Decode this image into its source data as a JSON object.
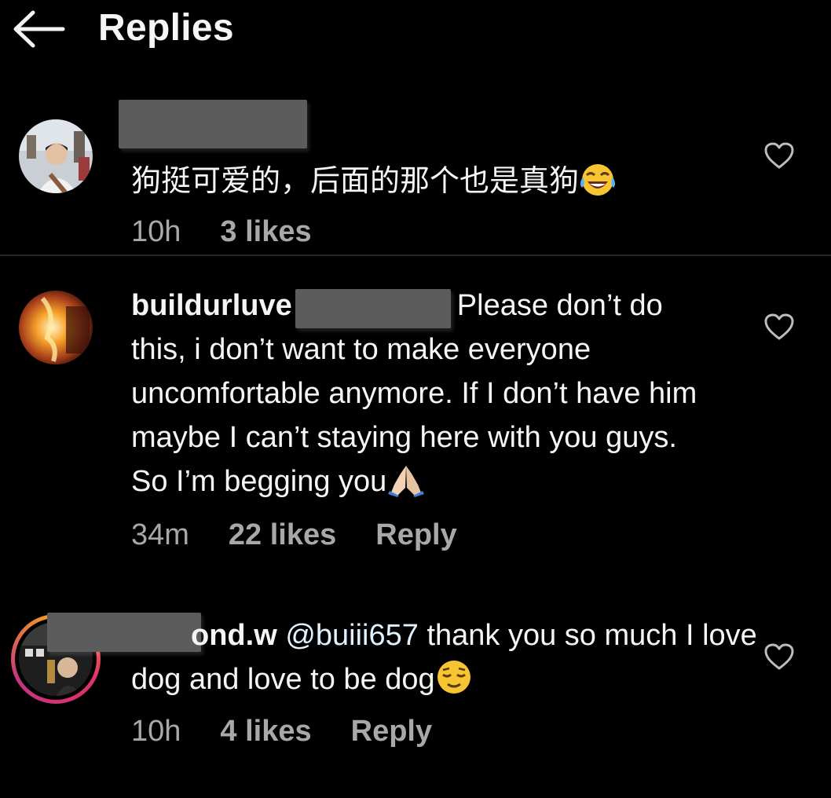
{
  "header": {
    "title": "Replies",
    "back_icon": "arrow-left-icon"
  },
  "comments": [
    {
      "username": "",
      "text": "狗挺可爱的，后面的那个也是真狗",
      "emoji": "face-with-tears-of-joy-emoji",
      "time": "10h",
      "likes": "3 likes",
      "reply": ""
    },
    {
      "username": "buildurluve",
      "text": "Please don’t do this, i don’t want to make everyone uncomfortable anymore. If I don’t have him maybe I can’t staying here with you guys. So I’m begging you",
      "emoji": "folded-hands-emoji",
      "time": "34m",
      "likes": "22 likes",
      "reply": "Reply"
    },
    {
      "username": "ond.w",
      "mention": "@buiii657",
      "text": " thank you so much I love dog and love to be dog",
      "emoji": "relieved-face-emoji",
      "time": "10h",
      "likes": "4 likes",
      "reply": "Reply"
    }
  ],
  "colors": {
    "background": "#000000",
    "text": "#f5f5f5",
    "meta": "#a8a8a8",
    "redaction": "#5c5c5c"
  }
}
